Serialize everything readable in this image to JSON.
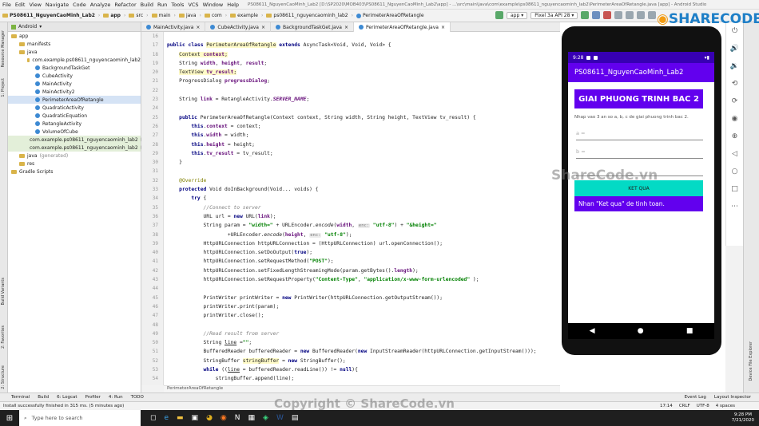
{
  "menubar": {
    "items": [
      "File",
      "Edit",
      "View",
      "Navigate",
      "Code",
      "Analyze",
      "Refactor",
      "Build",
      "Run",
      "Tools",
      "VCS",
      "Window",
      "Help"
    ],
    "title": "PS08611_NguyenCaoMinh_Lab2 [D:\\SP2020\\MOB403\\PS08611_NguyenCaoMinh_Lab2\\app] - ...\\src\\main\\java\\com\\example\\ps08611_nguyencaominh_lab2\\PerimeterAreaOfRetangle.java [app] - Android Studio"
  },
  "navbar": {
    "crumbs": [
      "PS08611_NguyenCaoMinh_Lab2",
      "app",
      "src",
      "main",
      "java",
      "com",
      "example",
      "ps08611_nguyencaominh_lab2",
      "PerimeterAreaOfRetangle"
    ],
    "run_config": "app",
    "device": "Pixel 3a API 28"
  },
  "left_strip": {
    "labels": [
      "1: Project",
      "Resource Manager",
      "2: Favorites",
      "Build Variants",
      "2: Structure"
    ]
  },
  "project": {
    "view": "Android",
    "tree": [
      {
        "label": "app",
        "indent": 0
      },
      {
        "label": "manifests",
        "indent": 1
      },
      {
        "label": "java",
        "indent": 1
      },
      {
        "label": "com.example.ps08611_nguyencaominh_lab2",
        "indent": 2
      },
      {
        "label": "BackgroundTaskGet",
        "indent": 3
      },
      {
        "label": "CubeActivity",
        "indent": 3
      },
      {
        "label": "MainActivity",
        "indent": 3
      },
      {
        "label": "MainActivity2",
        "indent": 3
      },
      {
        "label": "PerimeterAreaOfRetangle",
        "indent": 3,
        "selected": true
      },
      {
        "label": "QuadraticActivity",
        "indent": 3
      },
      {
        "label": "QuadraticEquation",
        "indent": 3
      },
      {
        "label": "RetangleActivity",
        "indent": 3
      },
      {
        "label": "VolumeOfCube",
        "indent": 3
      },
      {
        "label": "com.example.ps08611_nguyencaominh_lab2",
        "suffix": "(androidTest)",
        "indent": 2,
        "hl": true
      },
      {
        "label": "com.example.ps08611_nguyencaominh_lab2",
        "suffix": "(test)",
        "indent": 2,
        "hl": true
      },
      {
        "label": "java",
        "suffix": "(generated)",
        "indent": 1
      },
      {
        "label": "res",
        "indent": 1
      },
      {
        "label": "Gradle Scripts",
        "indent": 0
      }
    ]
  },
  "tabs": [
    {
      "label": "MainActivity.java"
    },
    {
      "label": "CubeActivity.java"
    },
    {
      "label": "BackgroundTaskGet.java"
    },
    {
      "label": "PerimeterAreaOfRetangle.java",
      "active": true
    }
  ],
  "line_numbers": [
    "16",
    "17",
    "18",
    "19",
    "20",
    "21",
    "22",
    "23",
    "24",
    "25",
    "26",
    "27",
    "28",
    "29",
    "30",
    "31",
    "32",
    "33",
    "34",
    "35",
    "36",
    "37",
    "38",
    "39",
    "40",
    "41",
    "42",
    "43",
    "44",
    "45",
    "46",
    "47",
    "48",
    "49",
    "50",
    "51",
    "52",
    "53",
    "54"
  ],
  "code_breadcrumb": "PerimeterAreaOfRetangle",
  "code_lines": [
    [],
    [
      [
        "kw",
        "public class "
      ],
      [
        "yl",
        "PerimeterAreaOfRetangle"
      ],
      [
        "kw",
        " extends "
      ],
      [
        "",
        "AsyncTask<Void, Void, Void> {"
      ]
    ],
    [
      [
        "",
        "    "
      ],
      [
        "yl",
        "Context "
      ],
      [
        "fldyl",
        "context"
      ],
      [
        "yl",
        ";"
      ]
    ],
    [
      [
        "",
        "    String "
      ],
      [
        "fld",
        "width"
      ],
      [
        "",
        ", "
      ],
      [
        "fld",
        "height"
      ],
      [
        "",
        ", "
      ],
      [
        "fld",
        "result"
      ],
      [
        "",
        ";"
      ]
    ],
    [
      [
        "",
        "    "
      ],
      [
        "yl",
        "TextView "
      ],
      [
        "fldyl",
        "tv_result"
      ],
      [
        "yl",
        ";"
      ]
    ],
    [
      [
        "",
        "    ProgressDialog "
      ],
      [
        "fld",
        "progressDialog"
      ],
      [
        "",
        ";"
      ]
    ],
    [],
    [
      [
        "",
        "    String "
      ],
      [
        "fld",
        "link"
      ],
      [
        "",
        " = RetangleActivity."
      ],
      [
        "stat",
        "SERVER_NAME"
      ],
      [
        "",
        ";"
      ]
    ],
    [],
    [
      [
        "kw",
        "    public "
      ],
      [
        "",
        "PerimeterAreaOfRetangle(Context context, String width, String height, TextView tv_result) {"
      ]
    ],
    [
      [
        "kw",
        "        this"
      ],
      [
        "",
        "."
      ],
      [
        "fld",
        "context"
      ],
      [
        "",
        " = context;"
      ]
    ],
    [
      [
        "kw",
        "        this"
      ],
      [
        "",
        "."
      ],
      [
        "fld",
        "width"
      ],
      [
        "",
        " = width;"
      ]
    ],
    [
      [
        "kw",
        "        this"
      ],
      [
        "",
        "."
      ],
      [
        "fld",
        "height"
      ],
      [
        "",
        " = height;"
      ]
    ],
    [
      [
        "kw",
        "        this"
      ],
      [
        "",
        "."
      ],
      [
        "fld",
        "tv_result"
      ],
      [
        "",
        " = tv_result;"
      ]
    ],
    [
      [
        "",
        "    }"
      ]
    ],
    [],
    [
      [
        "an",
        "    @Override"
      ]
    ],
    [
      [
        "kw",
        "    protected "
      ],
      [
        "",
        "Void doInBackground(Void... voids) {"
      ]
    ],
    [
      [
        "kw",
        "        try "
      ],
      [
        "",
        "{"
      ]
    ],
    [
      [
        "cm",
        "            //Connect to server"
      ]
    ],
    [
      [
        "",
        "            URL url = "
      ],
      [
        "kw",
        "new "
      ],
      [
        "",
        "URL("
      ],
      [
        "fld",
        "link"
      ],
      [
        "",
        ");"
      ]
    ],
    [
      [
        "",
        "            String param = "
      ],
      [
        "str",
        "\"width=\""
      ],
      [
        "",
        " + URLEncoder."
      ],
      [
        "it",
        "encode"
      ],
      [
        "",
        "("
      ],
      [
        "fld",
        "width"
      ],
      [
        "",
        ", "
      ],
      [
        "hint",
        "enc:"
      ],
      [
        "str",
        " \"utf-8\""
      ],
      [
        "",
        ") + "
      ],
      [
        "str",
        "\"&height=\""
      ]
    ],
    [
      [
        "",
        "                    +URLEncoder."
      ],
      [
        "it",
        "encode"
      ],
      [
        "",
        "("
      ],
      [
        "fld",
        "height"
      ],
      [
        "",
        ", "
      ],
      [
        "hint",
        "enc:"
      ],
      [
        "str",
        " \"utf-8\""
      ],
      [
        "",
        ");"
      ]
    ],
    [
      [
        "",
        "            HttpURLConnection httpURLConnection = (HttpURLConnection) url.openConnection();"
      ]
    ],
    [
      [
        "",
        "            httpURLConnection.setDoOutput("
      ],
      [
        "kw",
        "true"
      ],
      [
        "",
        ");"
      ]
    ],
    [
      [
        "",
        "            httpURLConnection.setRequestMethod("
      ],
      [
        "str",
        "\"POST\""
      ],
      [
        "",
        ");"
      ]
    ],
    [
      [
        "",
        "            httpURLConnection.setFixedLengthStreamingMode(param.getBytes()."
      ],
      [
        "fld",
        "length"
      ],
      [
        "",
        ");"
      ]
    ],
    [
      [
        "",
        "            httpURLConnection.setRequestProperty("
      ],
      [
        "str",
        "\"Content-Type\""
      ],
      [
        "",
        ", "
      ],
      [
        "str",
        "\"application/x-www-form-urlencoded\""
      ],
      [
        "",
        " );"
      ]
    ],
    [],
    [
      [
        "",
        "            PrintWriter printWriter = "
      ],
      [
        "kw",
        "new "
      ],
      [
        "",
        "PrintWriter(httpURLConnection.getOutputStream());"
      ]
    ],
    [
      [
        "",
        "            printWriter.print(param);"
      ]
    ],
    [
      [
        "",
        "            printWriter.close();"
      ]
    ],
    [],
    [
      [
        "cm",
        "            //Read result from server"
      ]
    ],
    [
      [
        "",
        "            String "
      ],
      [
        "ul",
        "line"
      ],
      [
        "",
        " ="
      ],
      [
        "str",
        "\"\""
      ],
      [
        "",
        ";"
      ]
    ],
    [
      [
        "",
        "            BufferedReader bufferedReader = "
      ],
      [
        "kw",
        "new "
      ],
      [
        "",
        "BufferedReader("
      ],
      [
        "kw",
        "new "
      ],
      [
        "",
        "InputStreamReader(httpURLConnection.getInputStream()));"
      ]
    ],
    [
      [
        "",
        "            StringBuffer "
      ],
      [
        "yl",
        "stringBuffer"
      ],
      [
        "",
        " = "
      ],
      [
        "kw",
        "new "
      ],
      [
        "",
        "StringBuffer();"
      ]
    ],
    [
      [
        "kw",
        "            while "
      ],
      [
        "",
        "(("
      ],
      [
        "ul",
        "line"
      ],
      [
        "",
        " = bufferedReader.readLine()) != "
      ],
      [
        "kw",
        "null"
      ],
      [
        "",
        "){"
      ]
    ],
    [
      [
        "",
        "                stringBuffer.append(line);"
      ]
    ]
  ],
  "toolwins": [
    "Terminal",
    "Build",
    "6: Logcat",
    "Profiler",
    "4: Run",
    "TODO",
    "Event Log",
    "Layout Inspector"
  ],
  "status": {
    "message": "Install successfully finished in 315 ms. (5 minutes ago)",
    "pos": "17:14",
    "crlf": "CRLF",
    "enc": "UTF-8",
    "indent": "4 spaces"
  },
  "taskbar": {
    "search": "Type here to search",
    "time": "9:28 PM",
    "date": "7/21/2020"
  },
  "phone": {
    "time": "9:28",
    "app_title": "PS08611_NguyenCaoMinh_Lab2",
    "header": "GIAI PHUONG TRINH BAC 2",
    "instruction": "Nhap vao 3 an so a, b, c de giai phuong trinh bac 2.",
    "hint_a": "a =",
    "hint_b": "b =",
    "button": "KET QUA",
    "result": "Nhan \"Ket qua\" de tinh toan."
  },
  "watermark": {
    "logo_text": "SHARECODE.vn",
    "center": "ShareCode.vn",
    "bottom": "Copyright © ShareCode.vn"
  },
  "right_strip": {
    "labels": [
      "Device File Explorer"
    ]
  },
  "colors": {
    "accent": "#6200ee",
    "teal": "#03dac5",
    "status": "#3700b3"
  }
}
